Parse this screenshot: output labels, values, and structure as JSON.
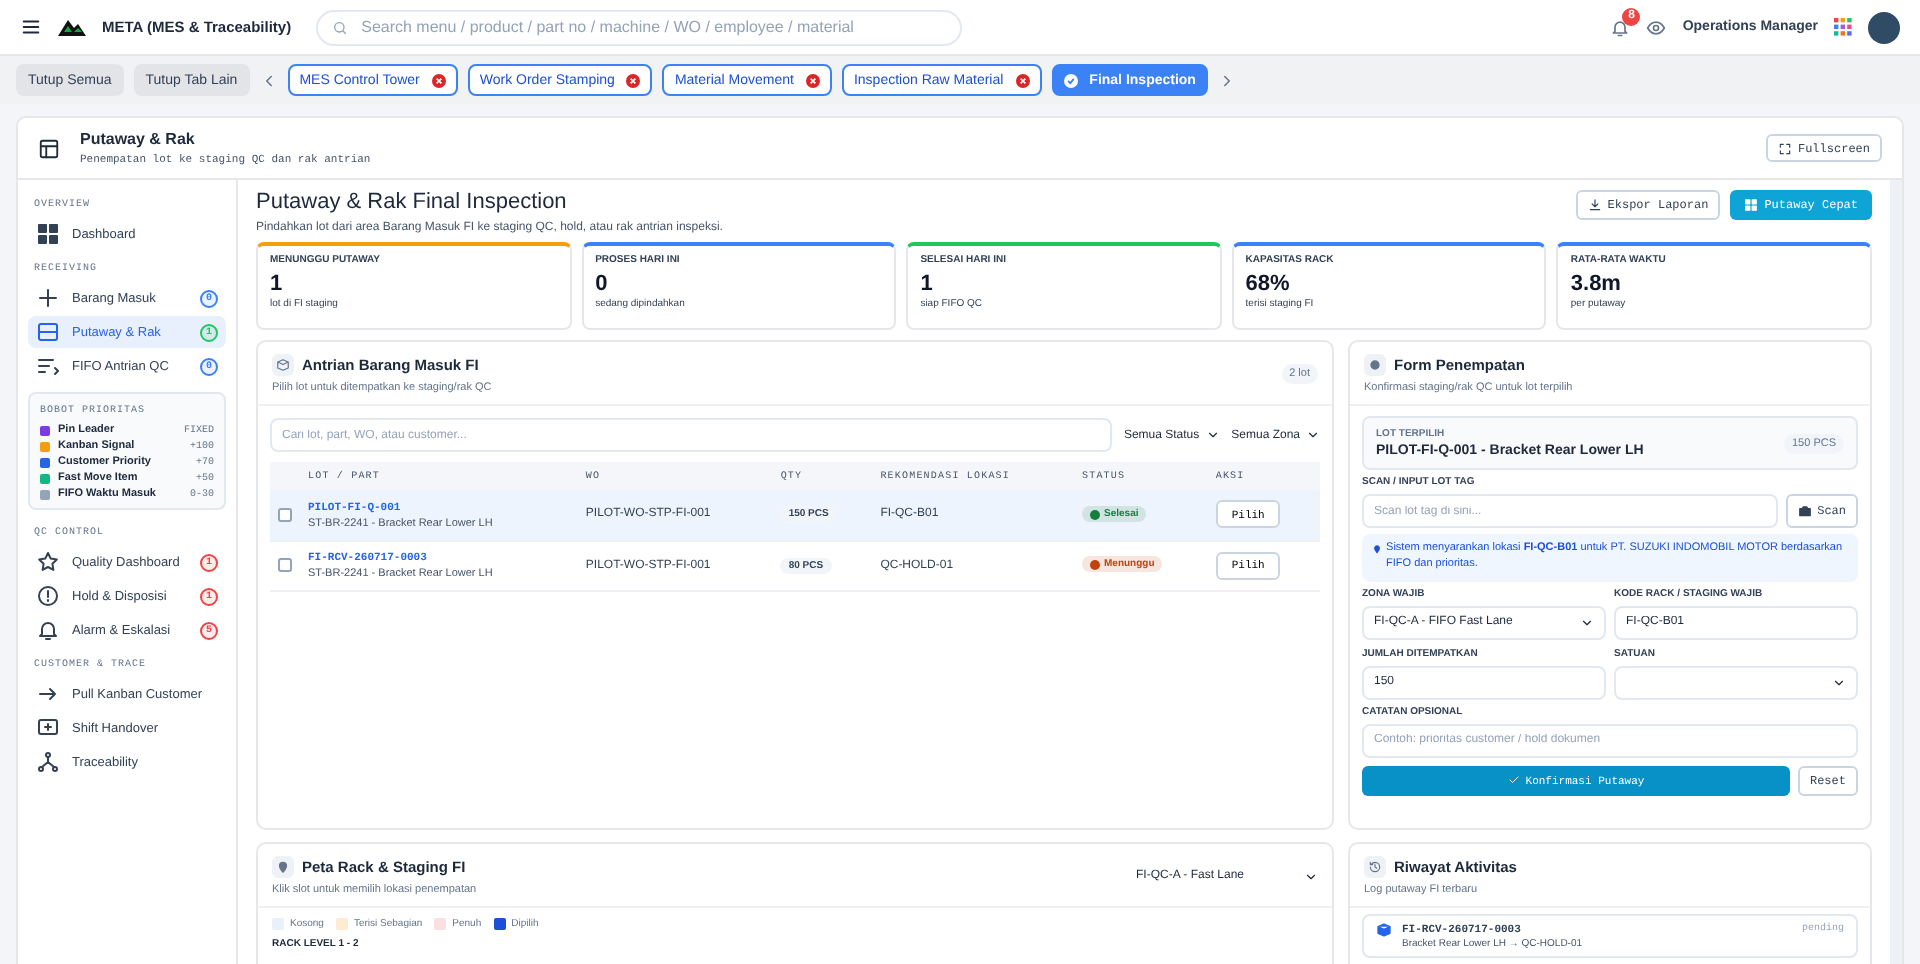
{
  "topbar": {
    "app_name": "META (MES & Traceability)",
    "search_placeholder": "Search menu / product / part no / machine / WO / employee / material",
    "notification_count": "8",
    "user_role": "Operations Manager"
  },
  "tab_bar": {
    "buttons": [
      "Tutup Semua",
      "Tutup Tab Lain"
    ],
    "tabs": [
      {
        "label": "MES Control Tower",
        "selected": false
      },
      {
        "label": "Work Order Stamping",
        "selected": false
      },
      {
        "label": "Material Movement",
        "selected": false
      },
      {
        "label": "Inspection Raw Material",
        "selected": false
      },
      {
        "label": "Final Inspection",
        "selected": true
      }
    ]
  },
  "page_header": {
    "title": "Putaway & Rak",
    "subtitle": "Penempatan lot ke staging QC dan rak antrian",
    "fullscreen_button": "Fullscreen"
  },
  "sidebar": {
    "blocks": [
      {
        "kind": "nav",
        "heading": "OVERVIEW",
        "items": [
          {
            "label": "Dashboard",
            "selected": false
          }
        ]
      },
      {
        "kind": "nav",
        "heading": "RECEIVING",
        "items": [
          {
            "label": "Barang Masuk",
            "selected": false,
            "badge": "0",
            "color": "#3b82f6"
          },
          {
            "label": "Putaway & Rak",
            "selected": true,
            "badge": "1",
            "color": "#22c55e"
          },
          {
            "label": "FIFO Antrian QC",
            "selected": false,
            "badge": "0",
            "color": "#3b82f6"
          }
        ]
      },
      {
        "kind": "priority",
        "heading": "BOBOT PRIORITAS",
        "items": [
          {
            "label": "Pin Leader",
            "value": "FIXED",
            "color": "#7c3aed"
          },
          {
            "label": "Kanban Signal",
            "value": "+100",
            "color": "#f59e0b"
          },
          {
            "label": "Customer Priority",
            "value": "+70",
            "color": "#2563eb"
          },
          {
            "label": "Fast Move Item",
            "value": "+50",
            "color": "#10b981"
          },
          {
            "label": "FIFO Waktu Masuk",
            "value": "0-30",
            "color": "#94a3b8"
          }
        ]
      },
      {
        "kind": "nav",
        "heading": "QC CONTROL",
        "items": [
          {
            "label": "Quality Dashboard",
            "selected": false,
            "badge": "1",
            "color": "#ef4444"
          },
          {
            "label": "Hold & Disposisi",
            "selected": false,
            "badge": "1",
            "color": "#ef4444"
          },
          {
            "label": "Alarm & Eskalasi",
            "selected": false,
            "badge": "5",
            "color": "#ef4444"
          }
        ]
      },
      {
        "kind": "nav",
        "heading": "CUSTOMER & TRACE",
        "items": [
          {
            "label": "Pull Kanban Customer",
            "selected": false
          },
          {
            "label": "Shift Handover",
            "selected": false
          },
          {
            "label": "Traceability",
            "selected": false
          }
        ]
      }
    ]
  },
  "main": {
    "title": "Putaway & Rak Final Inspection",
    "subtitle": "Pindahkan lot dari area Barang Masuk FI ke staging QC, hold, atau rak antrian inspeksi.",
    "actions": [
      "Ekspor Laporan",
      "Putaway Cepat"
    ],
    "stats": [
      {
        "label": "MENUNGGU PUTAWAY",
        "value": "1",
        "note": "lot di FI staging",
        "color": "#f59e0b"
      },
      {
        "label": "PROSES HARI INI",
        "value": "0",
        "note": "sedang dipindahkan",
        "color": "#3b82f6"
      },
      {
        "label": "SELESAI HARI INI",
        "value": "1",
        "note": "siap FIFO QC",
        "color": "#22c55e"
      },
      {
        "label": "KAPASITAS RACK",
        "value": "68%",
        "note": "terisi staging FI",
        "color": "#3b82f6"
      },
      {
        "label": "RATA-RATA WAKTU",
        "value": "3.8m",
        "note": "per putaway",
        "color": "#3b82f6"
      }
    ]
  },
  "queue": {
    "title": "Antrian Barang Masuk FI",
    "subtitle": "Pilih lot untuk ditempatkan ke staging/rak QC",
    "count": "2 lot",
    "search_placeholder": "Cari lot, part, WO, atau customer...",
    "filters": [
      "Semua Status",
      "Semua Zona"
    ],
    "columns": [
      "LOT / PART",
      "WO",
      "QTY",
      "REKOMENDASI LOKASI",
      "STATUS",
      "AKSI"
    ],
    "rows": [
      {
        "lot": "PILOT-FI-Q-001",
        "part": "ST-BR-2241 - Bracket Rear Lower LH",
        "wo": "PILOT-WO-STP-FI-001",
        "qty": "150 PCS",
        "location": "FI-QC-B01",
        "status": "Selesai",
        "color": "#15803d",
        "action": "Pilih",
        "selected": true,
        "checked": false
      },
      {
        "lot": "FI-RCV-260717-0003",
        "part": "ST-BR-2241 - Bracket Rear Lower LH",
        "wo": "PILOT-WO-STP-FI-001",
        "qty": "80 PCS",
        "location": "QC-HOLD-01",
        "status": "Menunggu",
        "color": "#c2410c",
        "action": "Pilih",
        "selected": false,
        "checked": false
      }
    ]
  },
  "form": {
    "title": "Form Penempatan",
    "subtitle": "Konfirmasi staging/rak QC untuk lot terpilih",
    "selected_lot": {
      "label": "LOT TERPILIH",
      "value": "PILOT-FI-Q-001 - Bracket Rear Lower LH",
      "qty": "150 PCS"
    },
    "scan": {
      "label": "SCAN / INPUT LOT TAG",
      "placeholder": "Scan lot tag di sini...",
      "button": "Scan"
    },
    "suggestion": "Sistem menyarankan lokasi **FI-QC-B01** untuk PT. SUZUKI INDOMOBIL MOTOR berdasarkan FIFO dan prioritas.",
    "fields": [
      {
        "label": "ZONA WAJIB",
        "kind": "select",
        "value": "FI-QC-A - FIFO Fast Lane"
      },
      {
        "label": "KODE RACK / STAGING WAJIB",
        "kind": "input",
        "value": "FI-QC-B01"
      },
      {
        "label": "JUMLAH DITEMPATKAN",
        "kind": "input",
        "value": "150"
      },
      {
        "label": "SATUAN",
        "kind": "select"
      }
    ],
    "notes": {
      "label": "CATATAN OPSIONAL",
      "placeholder": "Contoh: prioritas customer / hold dokumen"
    },
    "confirm_button": "Konfirmasi Putaway",
    "reset_button": "Reset"
  },
  "rack_map": {
    "title": "Peta Rack & Staging FI",
    "subtitle": "Klik slot untuk memilih lokasi penempatan",
    "zone_select": "FI-QC-A - Fast Lane",
    "legend": [
      {
        "label": "Kosong",
        "color": "#e8f0fc"
      },
      {
        "label": "Terisi Sebagian",
        "color": "#fdebd3"
      },
      {
        "label": "Penuh",
        "color": "#fbe0e3"
      },
      {
        "label": "Dipilih",
        "color": "#1d4ed8"
      }
    ],
    "level_heading": "RACK LEVEL 1 - 2"
  },
  "activity": {
    "title": "Riwayat Aktivitas",
    "subtitle": "Log putaway FI terbaru",
    "entries": [
      {
        "lot": "FI-RCV-260717-0003",
        "detail": "Bracket Rear Lower LH → QC-HOLD-01",
        "status": "pending"
      }
    ]
  }
}
